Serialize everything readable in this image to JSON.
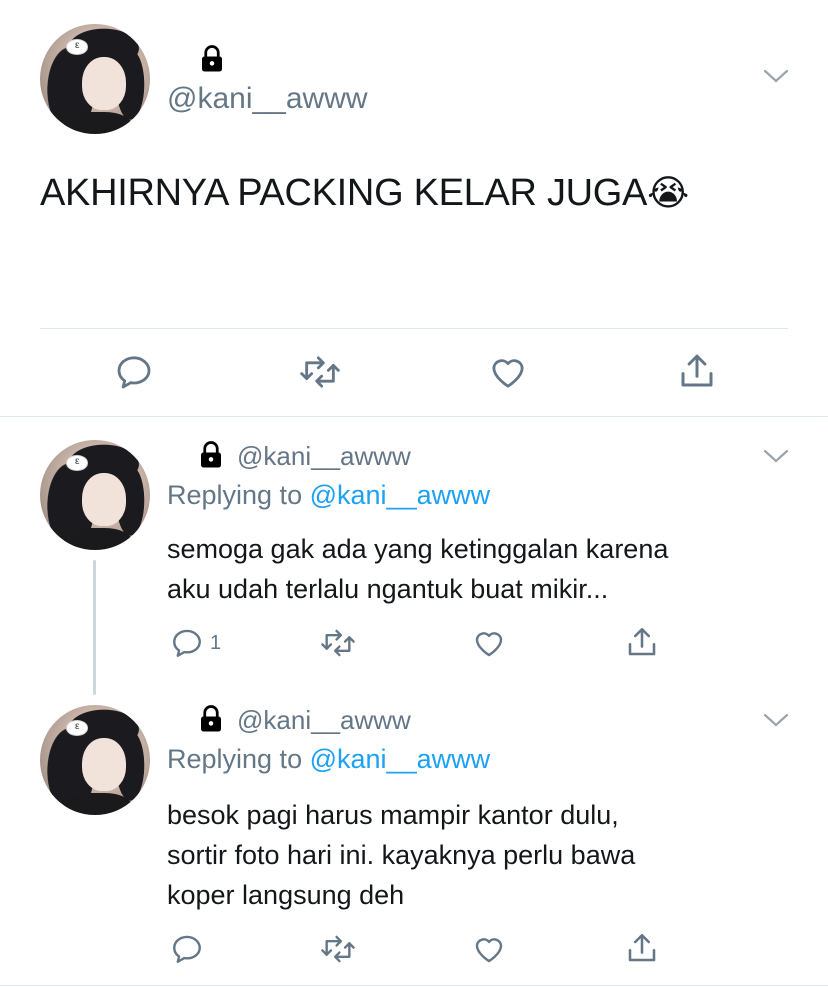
{
  "colors": {
    "text": "#14171a",
    "secondary": "#657786",
    "link": "#1da1f2",
    "divider": "#e1e8ed",
    "icon": "#657786"
  },
  "main_tweet": {
    "handle": "@kani__awww",
    "text": "AKHIRNYA PACKING KELAR JUGA",
    "emoji": "😭",
    "icons": [
      "lock-icon",
      "chevron-down-icon",
      "reply-icon",
      "retweet-icon",
      "like-icon",
      "share-icon"
    ]
  },
  "replies": [
    {
      "handle": "@kani__awww",
      "replying_label": "Replying to",
      "replying_to": "@kani__awww",
      "text_lines": [
        "semoga gak ada yang ketinggalan karena",
        "aku udah terlalu ngantuk buat mikir..."
      ],
      "reply_count": "1"
    },
    {
      "handle": "@kani__awww",
      "replying_label": "Replying to",
      "replying_to": "@kani__awww",
      "text_lines": [
        "besok pagi harus mampir kantor dulu,",
        "sortir foto hari ini. kayaknya perlu bawa",
        "koper langsung deh"
      ],
      "reply_count": ""
    }
  ]
}
